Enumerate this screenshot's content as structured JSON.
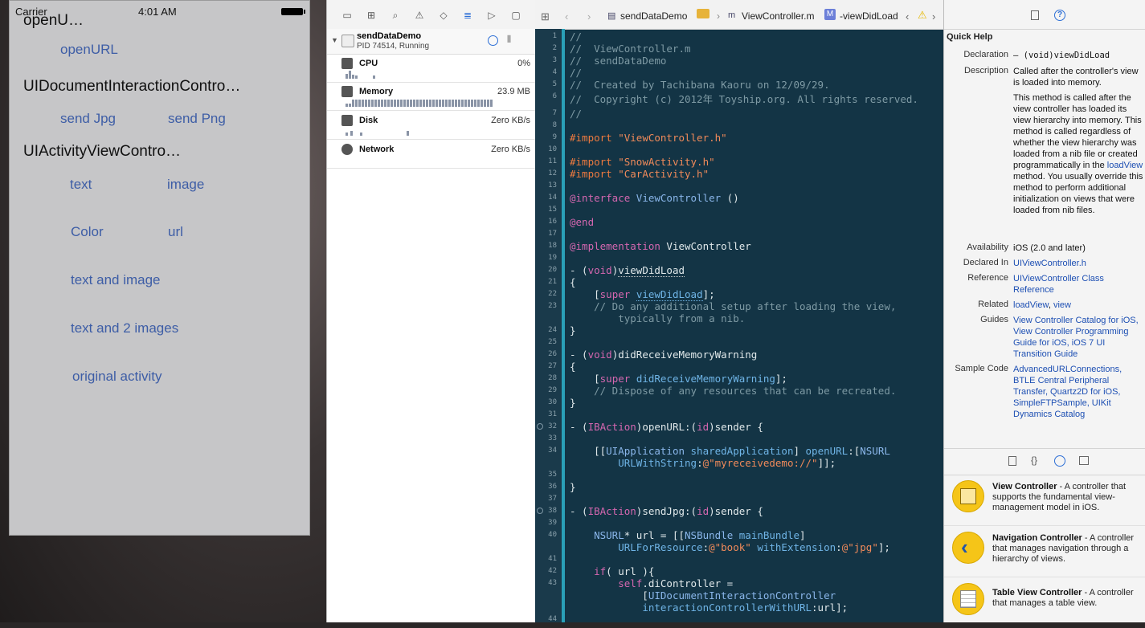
{
  "simulator": {
    "carrier": "Carrier",
    "time": "4:01 AM",
    "overlap_title": "openU…",
    "open_url_button": "openURL",
    "doc_section": "UIDocumentInteractionContro…",
    "send_jpg": "send Jpg",
    "send_png": "send Png",
    "activity_section": "UIActivityViewContro…",
    "text": "text",
    "image": "image",
    "color": "Color",
    "url": "url",
    "text_and_image": "text and image",
    "text_and_2_images": "text and 2 images",
    "original_activity": "original activity"
  },
  "debug_navigator": {
    "process_name": "sendDataDemo",
    "process_status": "PID 74514, Running",
    "gauges": [
      {
        "name": "CPU",
        "value": "0%"
      },
      {
        "name": "Memory",
        "value": "23.9 MB"
      },
      {
        "name": "Disk",
        "value": "Zero KB/s"
      },
      {
        "name": "Network",
        "value": "Zero KB/s"
      }
    ]
  },
  "jump_bar": {
    "project": "sendDataDemo",
    "file": "ViewController.m",
    "method_badge": "M",
    "method": "-viewDidLoad"
  },
  "editor": {
    "line_numbers": [
      "1",
      "2",
      "3",
      "4",
      "5",
      "6",
      "7",
      "8",
      "9",
      "10",
      "11",
      "12",
      "13",
      "14",
      "15",
      "16",
      "17",
      "18",
      "19",
      "20",
      "21",
      "22",
      "23",
      "24",
      "25",
      "26",
      "27",
      "28",
      "29",
      "30",
      "31",
      "32",
      "33",
      "34",
      "35",
      "36",
      "37",
      "38",
      "39",
      "40",
      "41",
      "42",
      "43",
      "44"
    ]
  },
  "quick_help": {
    "title": "Quick Help",
    "declaration_label": "Declaration",
    "declaration": "– (void)viewDidLoad",
    "description_label": "Description",
    "description_1": "Called after the controller's view is loaded into memory.",
    "description_2a": "This method is called after the view controller has loaded its view hierarchy into memory. This method is called regardless of whether the view hierarchy was loaded from a nib file or created programmatically in the ",
    "description_2_link": "loadView",
    "description_2b": " method. You usually override this method to perform additional initialization on views that were loaded from nib files.",
    "availability_label": "Availability",
    "availability": "iOS (2.0 and later)",
    "declared_in_label": "Declared In",
    "declared_in": "UIViewController.h",
    "reference_label": "Reference",
    "reference": "UIViewController Class Reference",
    "related_label": "Related",
    "related_1": "loadView",
    "related_2": "view",
    "guides_label": "Guides",
    "guides": "View Controller Catalog for iOS, View Controller Programming Guide for iOS, iOS 7 UI Transition Guide",
    "sample_code_label": "Sample Code",
    "sample_code": "AdvancedURLConnections, BTLE Central Peripheral Transfer, Quartz2D for iOS, SimpleFTPSample, UIKit Dynamics Catalog"
  },
  "library": [
    {
      "name": "View Controller",
      "desc": " - A controller that supports the fundamental view-management model in iOS."
    },
    {
      "name": "Navigation Controller",
      "desc": " - A controller that manages navigation through a hierarchy of views."
    },
    {
      "name": "Table View Controller",
      "desc": " - A controller that manages a table view."
    }
  ],
  "colors": {
    "editor_bg": "#133445",
    "ios_button": "#3d5da6",
    "library_icon": "#f5c518"
  }
}
